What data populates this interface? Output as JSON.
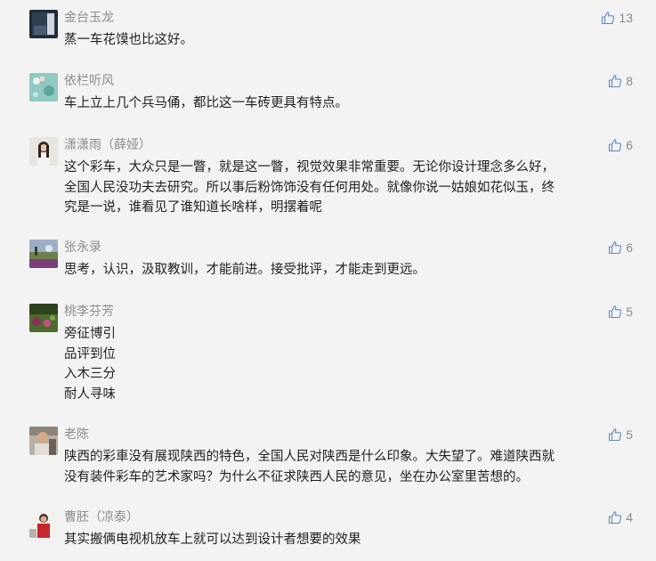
{
  "comments": [
    {
      "name": "金台玉龙",
      "text": "蒸一车花馍也比这好。",
      "likes": "13",
      "avatar_icon": "avatar-dark-photo"
    },
    {
      "name": "依栏听风",
      "text": "车上立上几个兵马俑，都比这一车砖更具有特点。",
      "likes": "8",
      "avatar_icon": "avatar-teal-pattern"
    },
    {
      "name": "潇潇雨（薛娅）",
      "text": "这个彩车，大众只是一瞥，就是这一瞥，视觉效果非常重要。无论你设计理念多么好，\n全国人民没功夫去研究。所以事后粉饰饰没有任何用处。就像你说一姑娘如花似玉，终\n究是一说，谁看见了谁知道长啥样，明摆着呢",
      "likes": "6",
      "avatar_icon": "avatar-person-photo"
    },
    {
      "name": "张永录",
      "text": "思考，认识，汲取教训，才能前进。接受批评，才能走到更远。",
      "likes": "6",
      "avatar_icon": "avatar-landscape-photo"
    },
    {
      "name": "桃李芬芳",
      "text": "旁征博引\n品评到位\n入木三分\n耐人寻味",
      "likes": "5",
      "avatar_icon": "avatar-garden-photo"
    },
    {
      "name": "老陈",
      "text": "陕西的彩車没有展现陕西的特色，全国人民对陕西是什么印象。大失望了。难道陕西就\n没有装件彩车的艺术家吗？为什么不征求陕西人民的意见，坐在办公室里苦想的。",
      "likes": "5",
      "avatar_icon": "avatar-man-photo"
    },
    {
      "name": "曹胚（凉泰）",
      "text": "其实搬俩电视机放车上就可以达到设计者想要的效果",
      "likes": "4",
      "avatar_icon": "avatar-red-person-photo"
    }
  ]
}
